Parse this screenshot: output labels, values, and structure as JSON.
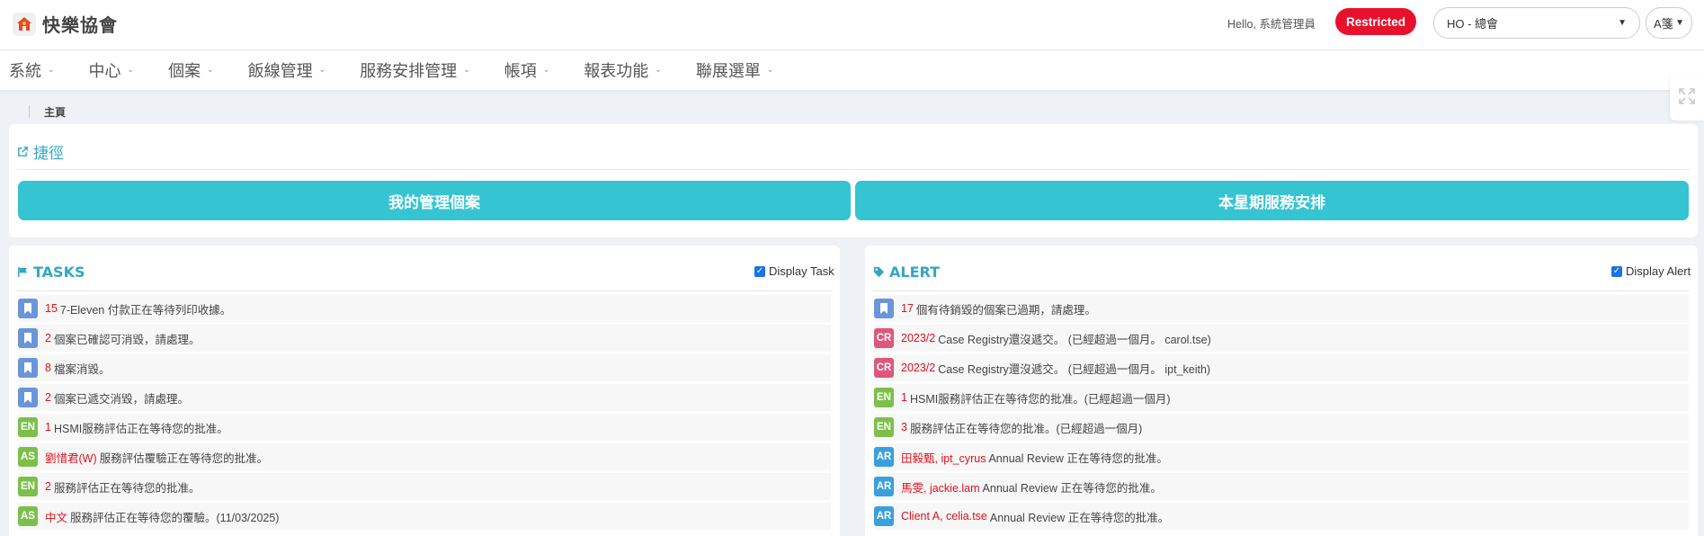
{
  "header": {
    "logo_text": "快樂協會",
    "hello": "Hello, 系統管理員",
    "restricted": "Restricted",
    "org": "HO - 總會",
    "lang": "A箋"
  },
  "nav": [
    {
      "label": "系統"
    },
    {
      "label": "中心"
    },
    {
      "label": "個案"
    },
    {
      "label": "飯線管理"
    },
    {
      "label": "服務安排管理"
    },
    {
      "label": "帳項"
    },
    {
      "label": "報表功能"
    },
    {
      "label": "聯展選單"
    }
  ],
  "breadcrumb": "主頁",
  "shortcut": {
    "title": "捷徑",
    "btn_cases": "我的管理個案",
    "btn_schedule": "本星期服務安排"
  },
  "tasks": {
    "title": "TASKS",
    "toggle": "Display Task",
    "items": [
      {
        "badge": "bookmark",
        "hl": "15",
        "text": "7-Eleven 付款正在等待列印收據。"
      },
      {
        "badge": "bookmark",
        "hl": "2",
        "text": "個案已確認可消毀，請處理。"
      },
      {
        "badge": "bookmark",
        "hl": "8",
        "text": "檔案消毀。"
      },
      {
        "badge": "bookmark",
        "hl": "2",
        "text": "個案已遞交消毀，請處理。"
      },
      {
        "badge": "EN",
        "hl": "1",
        "text": "HSMI服務評估正在等待您的批准。"
      },
      {
        "badge": "AS",
        "hl": "劉惜君(W)",
        "text": "服務評估覆驗正在等待您的批准。"
      },
      {
        "badge": "EN",
        "hl": "2",
        "text": "服務評估正在等待您的批准。"
      },
      {
        "badge": "AS",
        "hl": "中文",
        "text": "服務評估正在等待您的覆驗。(11/03/2025)"
      }
    ]
  },
  "alert": {
    "title": "ALERT",
    "toggle": "Display Alert",
    "items": [
      {
        "badge": "bookmark",
        "hl": "17",
        "text": "個有待銷毀的個案已過期，請處理。"
      },
      {
        "badge": "CR",
        "hl": "2023/2",
        "text": "Case Registry還沒遞交。 (已經超過一個月。 carol.tse)"
      },
      {
        "badge": "CR",
        "hl": "2023/2",
        "text": "Case Registry還沒遞交。 (已經超過一個月。 ipt_keith)"
      },
      {
        "badge": "EN",
        "hl": "1",
        "text": "HSMI服務評估正在等待您的批准。(已經超過一個月)"
      },
      {
        "badge": "EN",
        "hl": "3",
        "text": "服務評估正在等待您的批准。(已經超過一個月)"
      },
      {
        "badge": "AR",
        "hl": "田毅甄, ipt_cyrus",
        "text": "Annual Review 正在等待您的批准。"
      },
      {
        "badge": "AR",
        "hl": "馬雯, jackie.lam",
        "text": "Annual Review 正在等待您的批准。"
      },
      {
        "badge": "AR",
        "hl": "Client A, celia.tse",
        "text": "Annual Review 正在等待您的批准。"
      }
    ]
  },
  "badge_colors": {
    "bookmark": "#6b95d9",
    "EN": "#7cc04b",
    "AS": "#7cc04b",
    "CR": "#e0567c",
    "AR": "#3aa0dc"
  },
  "accent": "#33a7c2",
  "button_color": "#35c4d2",
  "highlight_color": "#e0101b"
}
